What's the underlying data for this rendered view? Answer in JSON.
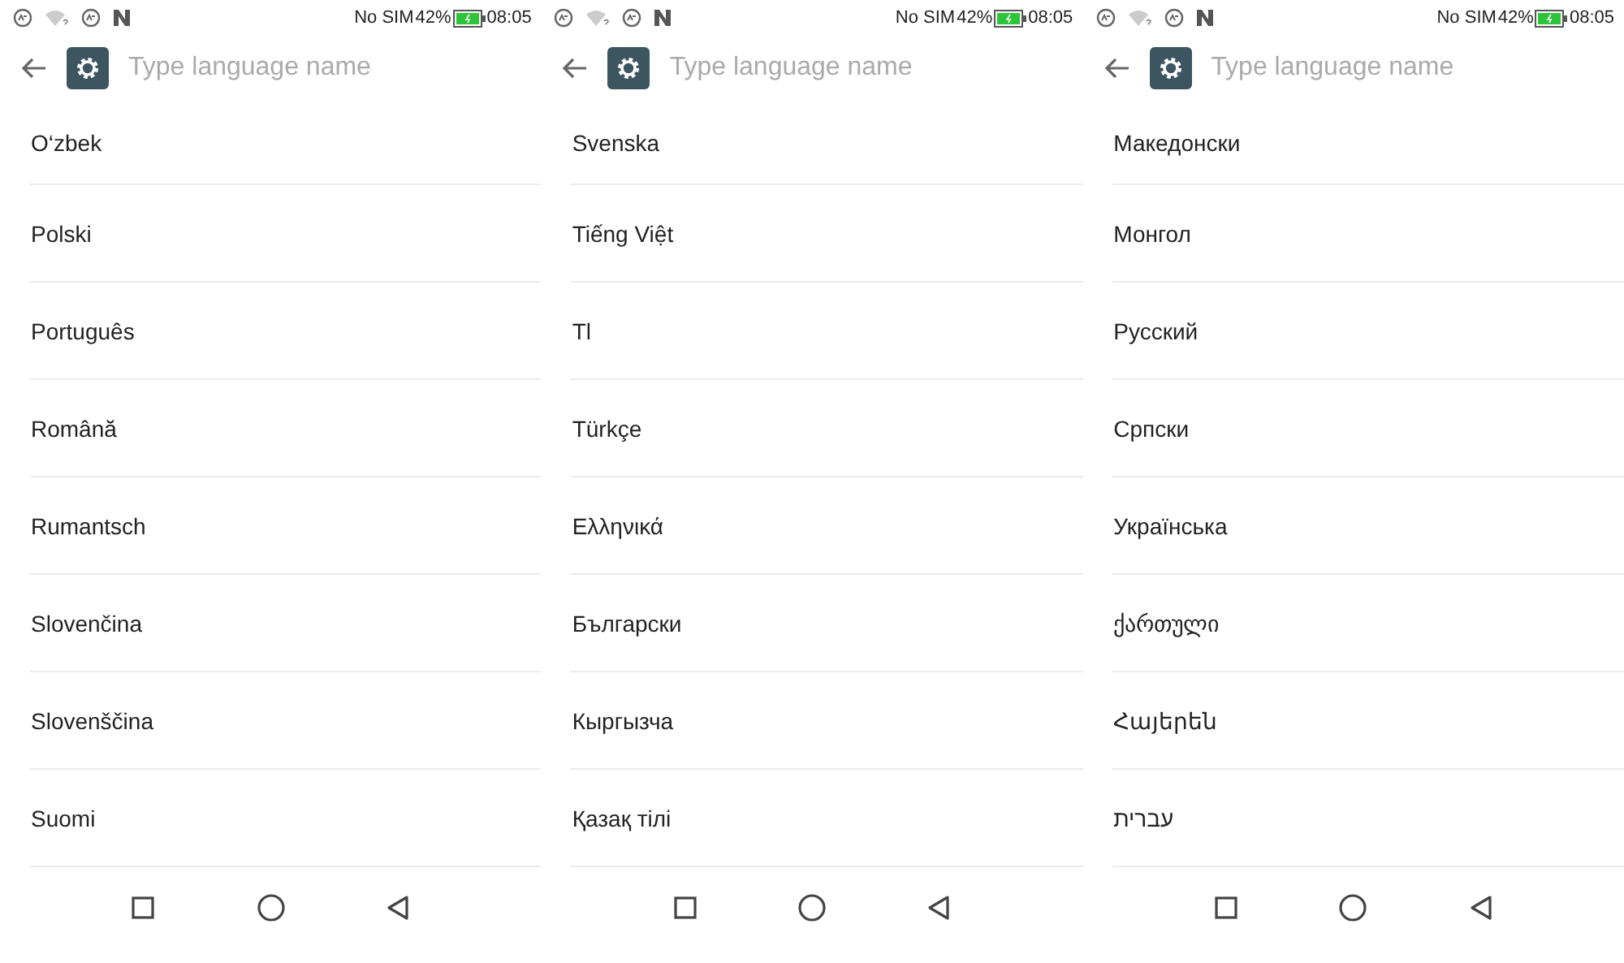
{
  "screens": [
    {
      "status_bar": {
        "carrier": "No SIM",
        "battery": "42%",
        "time": "08:05"
      },
      "search": {
        "placeholder": "Type language name"
      },
      "languages": [
        "O‘zbek",
        "Polski",
        "Português",
        "Română",
        "Rumantsch",
        "Slovenčina",
        "Slovenščina",
        "Suomi"
      ]
    },
    {
      "status_bar": {
        "carrier": "No SIM",
        "battery": "42%",
        "time": "08:05"
      },
      "search": {
        "placeholder": "Type language name"
      },
      "languages": [
        "Svenska",
        "Tiếng Việt",
        "Tl",
        "Türkçe",
        "Ελληνικά",
        "Български",
        "Кыргызча",
        "Қазақ тілі"
      ]
    },
    {
      "status_bar": {
        "carrier": "No SIM",
        "battery": "42%",
        "time": "08:05"
      },
      "search": {
        "placeholder": "Type language name"
      },
      "languages": [
        "Македонски",
        "Монгол",
        "Русский",
        "Српски",
        "Українська",
        "ქართული",
        "Հայերեն",
        "עברית"
      ]
    }
  ]
}
